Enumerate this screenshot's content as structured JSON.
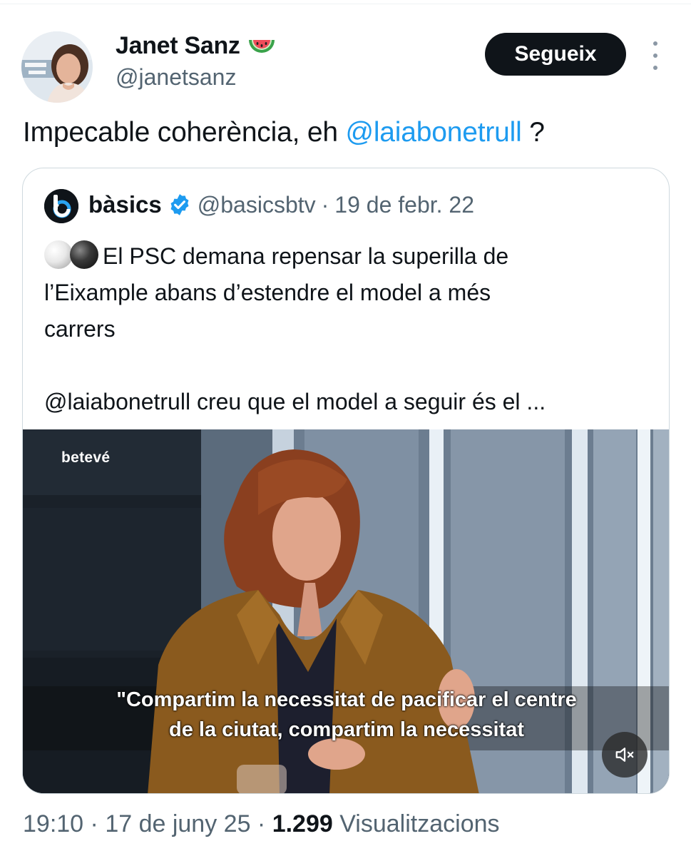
{
  "author": {
    "name": "Janet Sanz",
    "emoji": "watermelon-icon",
    "handle": "@janetsanz"
  },
  "follow_label": "Segueix",
  "tweet": {
    "text": "Impecable coherència, eh ",
    "mention": "@laiabonetrull",
    "suffix": " ?"
  },
  "quote": {
    "name": "bàsics",
    "handle": "@basicsbtv",
    "separator": "·",
    "date": "19 de febr. 22",
    "line1": "El PSC demana repensar la superilla de",
    "line2": "l’Eixample abans d’estendre el model a més",
    "line3": "carrers",
    "line4": "@laiabonetrull creu que el model a seguir és el ..."
  },
  "video": {
    "watermark": "betevé",
    "caption_line1": "\"Compartim la necessitat de pacificar el centre",
    "caption_line2": "de la ciutat, compartim la necessitat"
  },
  "footer": {
    "time": "19:10",
    "sep1": " · ",
    "date": "17 de juny 25",
    "sep2": " · ",
    "views_count": "1.299",
    "views_label": " Visualitzacions"
  },
  "colors": {
    "accent": "#1d9bf0",
    "text": "#0f1419",
    "muted": "#536471",
    "button": "#0f1419"
  }
}
